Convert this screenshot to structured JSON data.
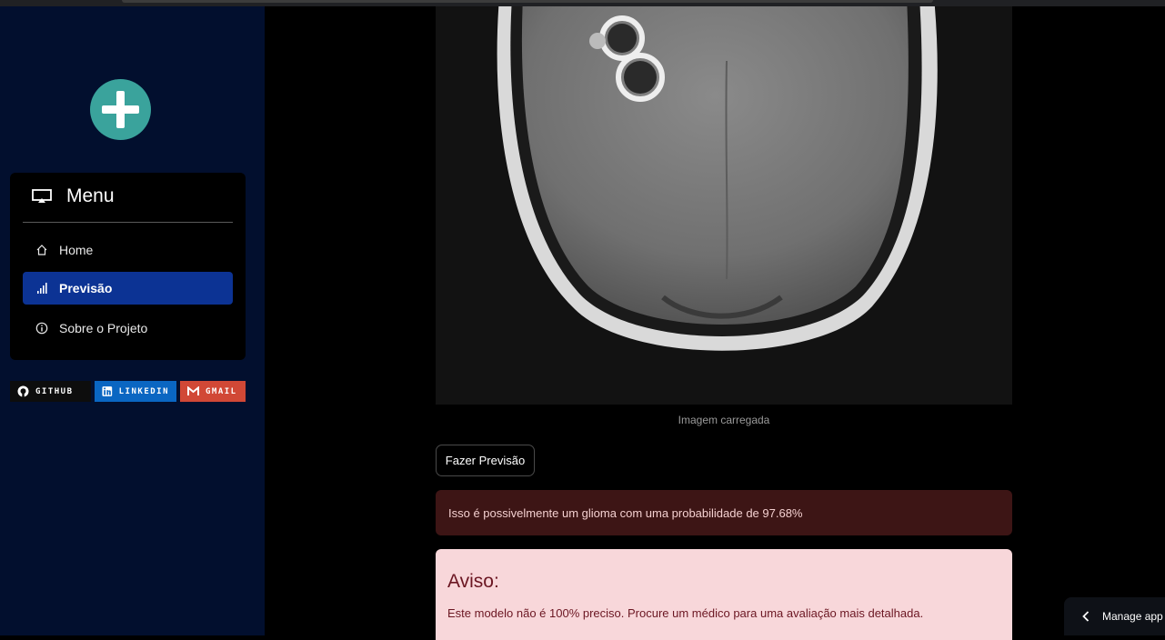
{
  "sidebar": {
    "menu_title": "Menu",
    "items": [
      {
        "label": "Home",
        "icon": "house-icon"
      },
      {
        "label": "Previsão",
        "icon": "bar-chart-icon",
        "active": true
      },
      {
        "label": "Sobre o Projeto",
        "icon": "info-icon"
      }
    ],
    "badges": [
      {
        "label": "GITHUB",
        "icon": "github-icon",
        "color": "#0d0d0d"
      },
      {
        "label": "LINKEDIN",
        "icon": "linkedin-icon",
        "color": "#0a66c2"
      },
      {
        "label": "GMAIL",
        "icon": "gmail-icon",
        "color": "#d14836"
      }
    ],
    "logo_icon": "plus-circle-icon",
    "accent": "#0c3394"
  },
  "main": {
    "image_caption": "Imagem carregada",
    "predict_button": "Fazer Previsão",
    "result_text": "Isso é possivelmente um glioma com uma probabilidade de 97.68%",
    "warning": {
      "title": "Aviso:",
      "text": "Este modelo não é 100% preciso. Procure um médico para uma avaliação mais detalhada."
    }
  },
  "footer": {
    "manage_app": "Manage app"
  }
}
